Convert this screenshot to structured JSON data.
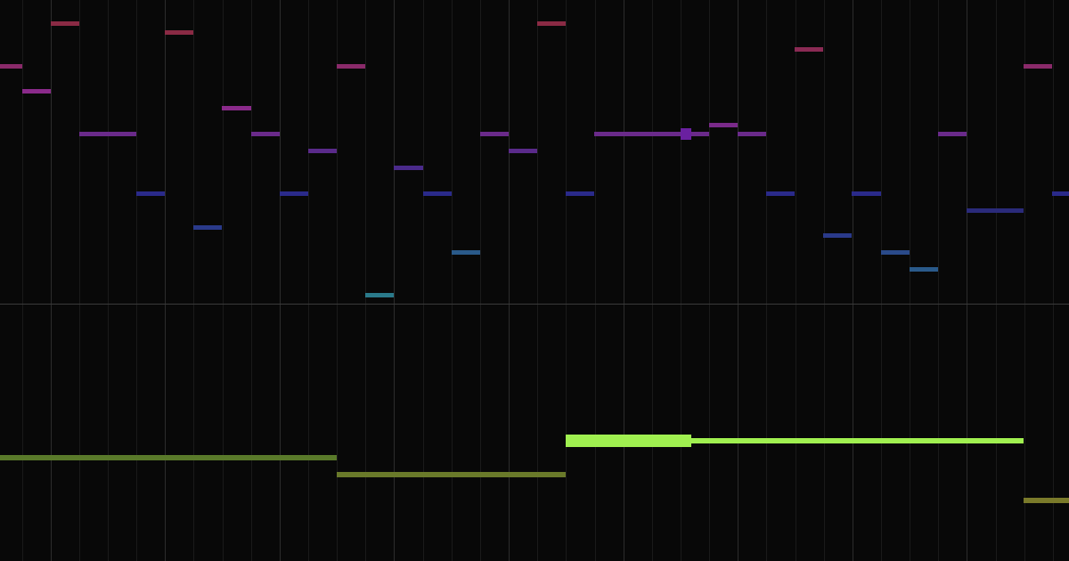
{
  "colors": {
    "background": "#080808",
    "grid_minor": "#1a1a1a",
    "grid_major": "#2c2c2c",
    "divider": "#3a3a3a",
    "pitch_high": "#8a2a44",
    "pitch_upper": "#8a2a6a",
    "pitch_mid_high": "#8a2a8a",
    "pitch_mid": "#6a2a8a",
    "pitch_mid_low": "#4a2a8a",
    "pitch_low": "#2a2a8a",
    "pitch_lower": "#2a3a8a",
    "pitch_lowest": "#2a5a8a",
    "pitch_bottom": "#2a7a8a",
    "bass_a": "#5a7a2a",
    "bass_b": "#6a7a2a",
    "bass_bright": "#a0f050",
    "bass_c": "#7a7a2a",
    "selected": "#6a20a0"
  }
}
